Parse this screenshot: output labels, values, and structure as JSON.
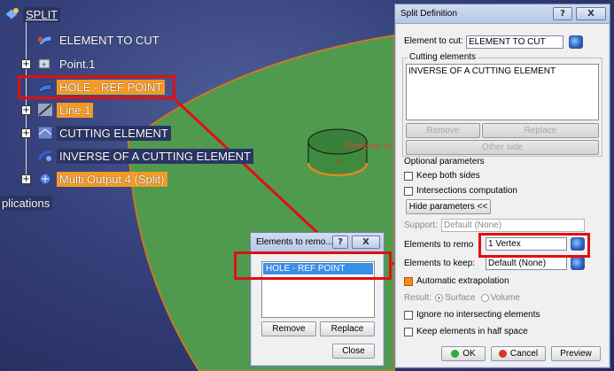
{
  "tree": {
    "root": "SPLIT",
    "items": [
      {
        "label": "ELEMENT TO CUT",
        "icon": "element-to-cut-icon"
      },
      {
        "label": "Point.1",
        "icon": "point-icon"
      },
      {
        "label": "HOLE - REF POINT",
        "icon": "hole-icon"
      },
      {
        "label": "Line.1",
        "icon": "line-icon"
      },
      {
        "label": "CUTTING ELEMENT",
        "icon": "cutting-element-icon"
      },
      {
        "label": "INVERSE OF A CUTTING ELEMENT",
        "icon": "inverse-icon"
      },
      {
        "label": "Multi Output.4 (Split)",
        "icon": "multi-output-icon"
      }
    ],
    "applications_fragment": "plications"
  },
  "viewport": {
    "annotation": "Elements to"
  },
  "split_dialog": {
    "title": "Split Definition",
    "help_btn": "?",
    "close_btn": "X",
    "element_to_cut_label": "Element to cut:",
    "element_to_cut_value": "ELEMENT TO CUT",
    "cutting_elements_title": "Cutting elements",
    "cutting_elements_list": [
      "INVERSE OF A CUTTING ELEMENT"
    ],
    "remove_btn": "Remove",
    "replace_btn": "Replace",
    "other_side_btn": "Other side",
    "optional_params_label": "Optional parameters",
    "keep_both_sides_label": "Keep both sides",
    "intersections_label": "Intersections computation",
    "hide_params_btn": "Hide parameters <<",
    "support_label": "Support:",
    "support_value": "Default (None)",
    "elements_to_remove_label": "Elements to remo",
    "elements_to_remove_value": "1 Vertex",
    "elements_to_keep_label": "Elements to keep:",
    "elements_to_keep_value": "Default (None)",
    "auto_extrapolation_label": "Automatic extrapolation",
    "result_label": "Result:",
    "surface_label": "Surface",
    "volume_label": "Volume",
    "ignore_label": "Ignore no intersecting elements",
    "keep_half_label": "Keep elements in half space",
    "ok_btn": "OK",
    "cancel_btn": "Cancel",
    "preview_btn": "Preview"
  },
  "remove_dialog": {
    "title": "Elements to remo...",
    "help_btn": "?",
    "close_x": "X",
    "list": [
      "HOLE - REF POINT"
    ],
    "remove_btn": "Remove",
    "replace_btn": "Replace",
    "close_btn": "Close"
  },
  "colors": {
    "surface": "#4f9a4f",
    "highlight_orange": "#f59a23",
    "red_callout": "#e01010",
    "selection_blue": "#3a8fe6"
  }
}
